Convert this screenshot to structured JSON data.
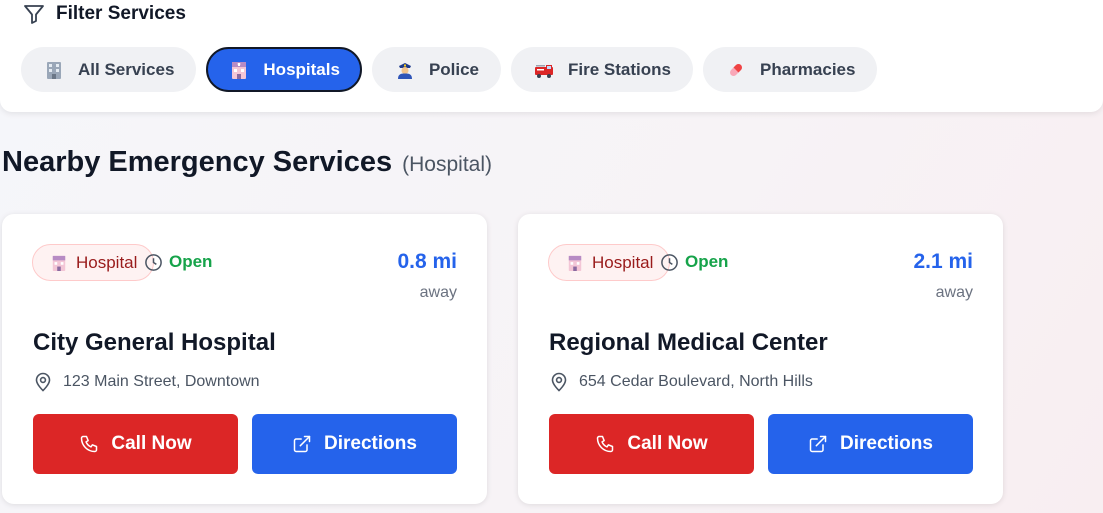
{
  "filter": {
    "title": "Filter Services",
    "chips": [
      {
        "label": "All Services",
        "icon": "building-icon",
        "active": false
      },
      {
        "label": "Hospitals",
        "icon": "hospital-icon",
        "active": true
      },
      {
        "label": "Police",
        "icon": "police-officer-icon",
        "active": false
      },
      {
        "label": "Fire Stations",
        "icon": "fire-engine-icon",
        "active": false
      },
      {
        "label": "Pharmacies",
        "icon": "pill-icon",
        "active": false
      }
    ]
  },
  "section": {
    "title": "Nearby Emergency Services",
    "filter_label": "(Hospital)"
  },
  "cards": [
    {
      "type": "Hospital",
      "status": "Open",
      "distance": "0.8 mi",
      "away": "away",
      "name": "City General Hospital",
      "address": "123 Main Street, Downtown",
      "call_label": "Call Now",
      "directions_label": "Directions"
    },
    {
      "type": "Hospital",
      "status": "Open",
      "distance": "2.1 mi",
      "away": "away",
      "name": "Regional Medical Center",
      "address": "654 Cedar Boulevard, North Hills",
      "call_label": "Call Now",
      "directions_label": "Directions"
    }
  ],
  "colors": {
    "primary": "#2563eb",
    "danger": "#dc2626",
    "success": "#16a34a",
    "badge_bg": "#fef2f2",
    "badge_text": "#991b1b"
  }
}
